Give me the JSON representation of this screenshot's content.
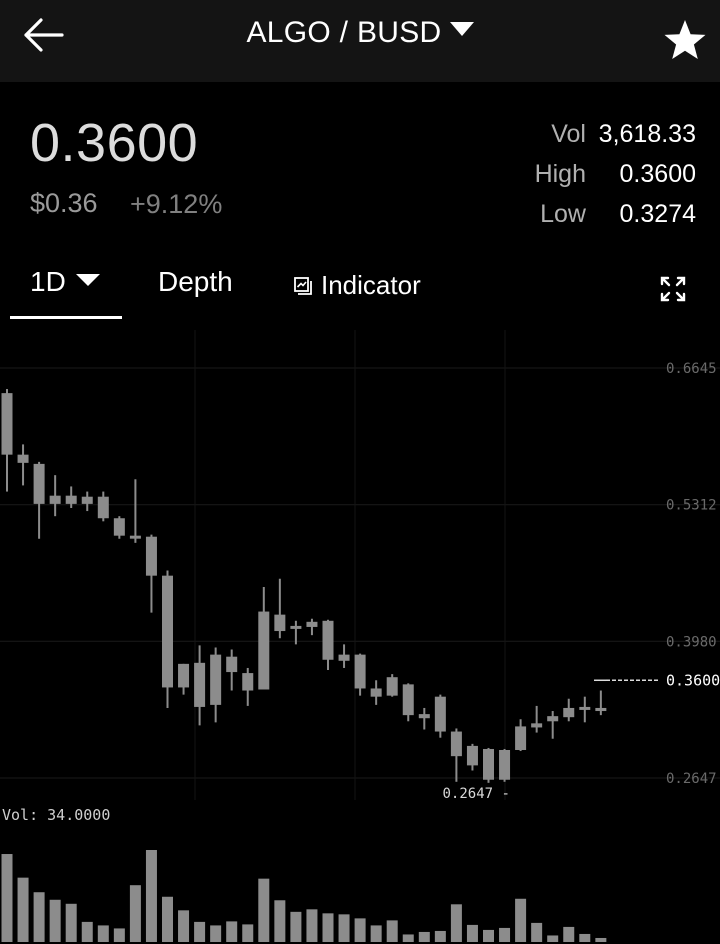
{
  "header": {
    "back_icon": "arrow-left-icon",
    "pair": "ALGO / BUSD",
    "favorite_icon": "star-icon"
  },
  "ticker": {
    "price": "0.3600",
    "fiat_price": "$0.36",
    "change": "+9.12%",
    "vol_label": "Vol",
    "vol_value": "3,618.33",
    "high_label": "High",
    "high_value": "0.3600",
    "low_label": "Low",
    "low_value": "0.3274"
  },
  "tabs": {
    "interval": "1D",
    "depth": "Depth",
    "indicator": "Indicator",
    "fullscreen_icon": "expand-icon"
  },
  "chart_data": {
    "type": "candlestick",
    "y_ticks": [
      "0.6645",
      "0.5312",
      "0.3980",
      "0.2647"
    ],
    "current_price_label": "0.3600",
    "min_label": "0.2647",
    "volume_label": "Vol: 34.0000",
    "colors": {
      "candle": "#8c8c8c",
      "grid": "#1a1a1a"
    },
    "ohlc": [
      [
        0.64,
        0.644,
        0.544,
        0.58
      ],
      [
        0.58,
        0.59,
        0.55,
        0.572
      ],
      [
        0.571,
        0.573,
        0.498,
        0.532
      ],
      [
        0.532,
        0.56,
        0.52,
        0.54
      ],
      [
        0.54,
        0.549,
        0.528,
        0.532
      ],
      [
        0.532,
        0.544,
        0.525,
        0.539
      ],
      [
        0.539,
        0.544,
        0.515,
        0.518
      ],
      [
        0.518,
        0.52,
        0.498,
        0.501
      ],
      [
        0.501,
        0.556,
        0.494,
        0.501
      ],
      [
        0.5,
        0.502,
        0.426,
        0.462
      ],
      [
        0.462,
        0.467,
        0.333,
        0.353
      ],
      [
        0.353,
        0.376,
        0.346,
        0.376
      ],
      [
        0.377,
        0.394,
        0.316,
        0.334
      ],
      [
        0.336,
        0.392,
        0.319,
        0.385
      ],
      [
        0.383,
        0.39,
        0.35,
        0.368
      ],
      [
        0.367,
        0.372,
        0.335,
        0.35
      ],
      [
        0.351,
        0.451,
        0.351,
        0.427
      ],
      [
        0.424,
        0.459,
        0.401,
        0.408
      ],
      [
        0.411,
        0.418,
        0.395,
        0.413
      ],
      [
        0.412,
        0.42,
        0.404,
        0.417
      ],
      [
        0.418,
        0.419,
        0.37,
        0.38
      ],
      [
        0.379,
        0.395,
        0.372,
        0.385
      ],
      [
        0.385,
        0.386,
        0.345,
        0.352
      ],
      [
        0.352,
        0.36,
        0.336,
        0.344
      ],
      [
        0.345,
        0.366,
        0.344,
        0.363
      ],
      [
        0.356,
        0.357,
        0.32,
        0.326
      ],
      [
        0.327,
        0.333,
        0.312,
        0.323
      ],
      [
        0.344,
        0.346,
        0.304,
        0.31
      ],
      [
        0.31,
        0.313,
        0.261,
        0.286
      ],
      [
        0.296,
        0.298,
        0.272,
        0.277
      ],
      [
        0.293,
        0.294,
        0.26,
        0.263
      ],
      [
        0.263,
        0.293,
        0.261,
        0.292
      ],
      [
        0.292,
        0.322,
        0.291,
        0.315
      ],
      [
        0.314,
        0.335,
        0.309,
        0.318
      ],
      [
        0.32,
        0.33,
        0.303,
        0.325
      ],
      [
        0.324,
        0.342,
        0.32,
        0.333
      ],
      [
        0.332,
        0.344,
        0.319,
        0.334
      ],
      [
        0.33,
        0.35,
        0.326,
        0.333
      ]
    ],
    "volumes": [
      17.5,
      12.8,
      9.9,
      8.4,
      7.6,
      4.0,
      3.3,
      2.7,
      11.3,
      18.3,
      9.0,
      6.3,
      4.0,
      3.3,
      4.1,
      3.5,
      12.6,
      8.3,
      6.0,
      6.5,
      5.7,
      5.5,
      4.7,
      3.3,
      4.3,
      1.5,
      2.0,
      2.2,
      7.5,
      3.4,
      2.4,
      2.8,
      8.6,
      3.8,
      1.3,
      3.0,
      1.6,
      0.8
    ]
  }
}
